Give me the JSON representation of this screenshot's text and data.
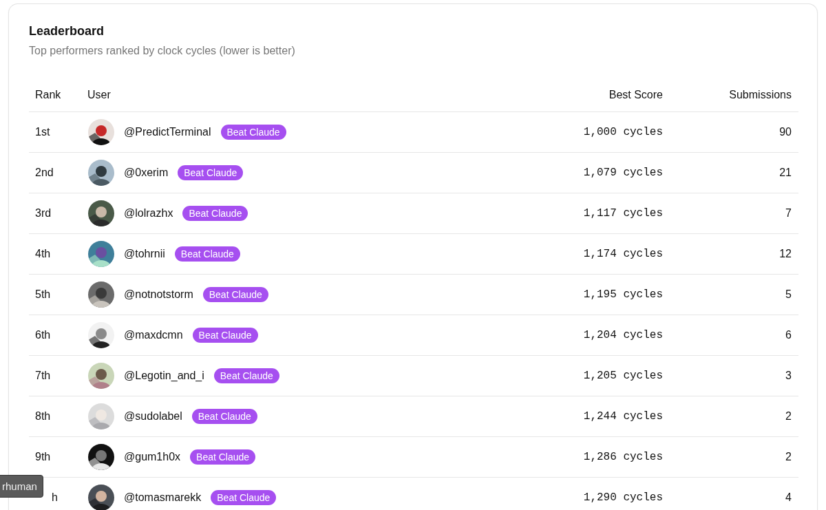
{
  "leaderboard": {
    "title": "Leaderboard",
    "subtitle": "Top performers ranked by clock cycles (lower is better)",
    "columns": [
      "Rank",
      "User",
      "Best Score",
      "Submissions"
    ],
    "rows": [
      {
        "rank": "1st",
        "user": "@PredictTerminal",
        "badge": "Beat Claude",
        "score": "1,000 cycles",
        "submissions": "90"
      },
      {
        "rank": "2nd",
        "user": "@0xerim",
        "badge": "Beat Claude",
        "score": "1,079 cycles",
        "submissions": "21"
      },
      {
        "rank": "3rd",
        "user": "@lolrazhx",
        "badge": "Beat Claude",
        "score": "1,117 cycles",
        "submissions": "7"
      },
      {
        "rank": "4th",
        "user": "@tohrnii",
        "badge": "Beat Claude",
        "score": "1,174 cycles",
        "submissions": "12"
      },
      {
        "rank": "5th",
        "user": "@notnotstorm",
        "badge": "Beat Claude",
        "score": "1,195 cycles",
        "submissions": "5"
      },
      {
        "rank": "6th",
        "user": "@maxdcmn",
        "badge": "Beat Claude",
        "score": "1,204 cycles",
        "submissions": "6"
      },
      {
        "rank": "7th",
        "user": "@Legotin_and_i",
        "badge": "Beat Claude",
        "score": "1,205 cycles",
        "submissions": "3"
      },
      {
        "rank": "8th",
        "user": "@sudolabel",
        "badge": "Beat Claude",
        "score": "1,244 cycles",
        "submissions": "2"
      },
      {
        "rank": "9th",
        "user": "@gum1h0x",
        "badge": "Beat Claude",
        "score": "1,286 cycles",
        "submissions": "2"
      },
      {
        "rank": "h",
        "user": "@tomasmarekk",
        "badge": "Beat Claude",
        "score": "1,290 cycles",
        "submissions": "4"
      }
    ]
  },
  "tooltip": {
    "text": "rhuman"
  }
}
